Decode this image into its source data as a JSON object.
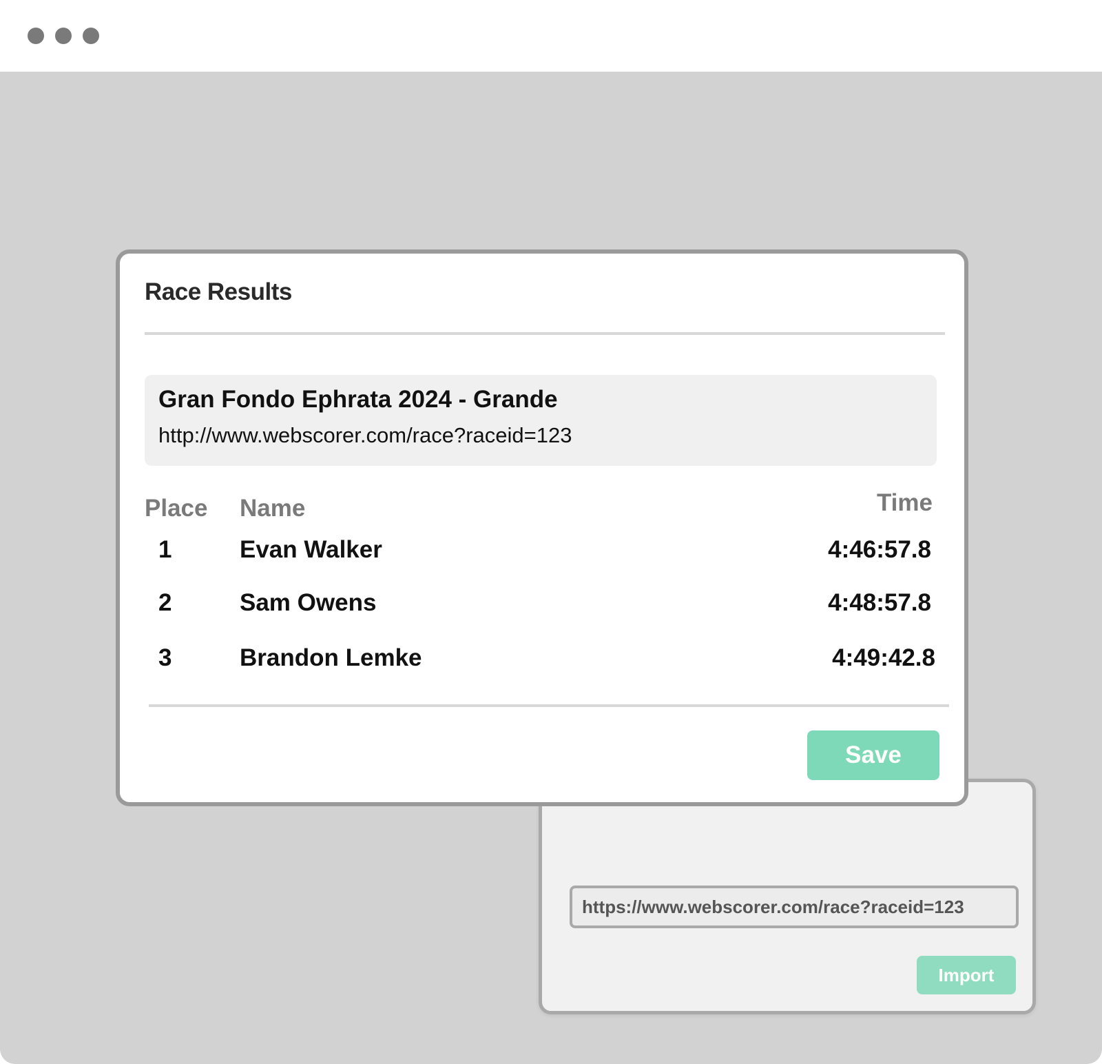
{
  "window": {
    "controls": [
      "dot",
      "dot",
      "dot"
    ]
  },
  "dialog": {
    "title": "Race Results",
    "race": {
      "name": "Gran Fondo Ephrata 2024 - Grande",
      "url": "http://www.webscorer.com/race?raceid=123"
    },
    "columns": {
      "place": "Place",
      "name": "Name",
      "time": "Time"
    },
    "rows": [
      {
        "place": "1",
        "name": "Evan Walker",
        "time": "4:46:57.8"
      },
      {
        "place": "2",
        "name": "Sam Owens",
        "time": "4:48:57.8"
      },
      {
        "place": "3",
        "name": "Brandon Lemke",
        "time": "4:49:42.8"
      }
    ],
    "save_label": "Save"
  },
  "import_panel": {
    "url_value": "https://www.webscorer.com/race?raceid=123",
    "import_label": "Import"
  },
  "colors": {
    "accent": "#7dd9b8",
    "accent_light": "#8fdcc0",
    "backdrop": "#d2d2d2",
    "border": "#9a9a9a"
  }
}
